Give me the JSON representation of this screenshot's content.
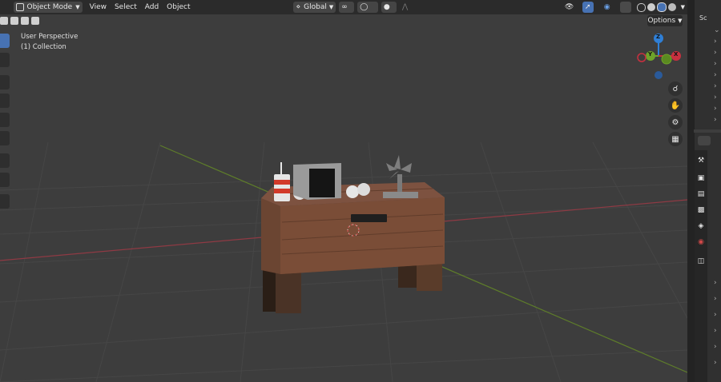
{
  "header": {
    "mode": "Object Mode",
    "menus": [
      "View",
      "Select",
      "Add",
      "Object"
    ],
    "transform_orientation": "Global",
    "options_label": "Options"
  },
  "viewport": {
    "view_name": "User Perspective",
    "collection_label": "(1) Collection"
  },
  "gizmo": {
    "z_label": "Z",
    "y_label": "Y",
    "x_label": "X"
  },
  "outliner": {
    "header_label": "Sc"
  },
  "colors": {
    "x_axis": "#c8303f",
    "y_axis": "#6ea32a",
    "z_axis": "#2f7fd6",
    "active_tool": "#4772b3"
  },
  "icons": [
    "cursor-icon",
    "select-icon",
    "move-icon",
    "rotate-icon",
    "scale-icon",
    "transform-icon",
    "annotate-icon",
    "measure-icon",
    "add-cube-icon",
    "zoom-icon",
    "hand-icon",
    "camera-icon",
    "grid-icon"
  ]
}
